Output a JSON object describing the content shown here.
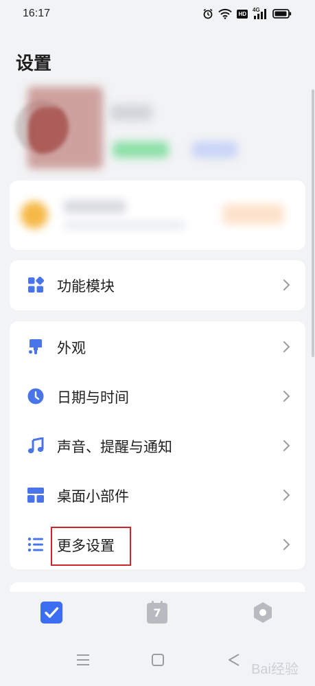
{
  "status_bar": {
    "time": "16:17",
    "hd_badge": "HD",
    "network": "4G",
    "battery_percent": 85
  },
  "page": {
    "title": "设置"
  },
  "module_card": {
    "label": "功能模块"
  },
  "settings_list": {
    "items": [
      {
        "label": "外观",
        "icon": "paint-brush-icon"
      },
      {
        "label": "日期与时间",
        "icon": "clock-icon"
      },
      {
        "label": "声音、提醒与通知",
        "icon": "music-note-icon"
      },
      {
        "label": "桌面小部件",
        "icon": "widget-icon"
      },
      {
        "label": "更多设置",
        "icon": "list-icon"
      }
    ]
  },
  "bottom_nav": {
    "calendar_day": "7",
    "active_tab": "tasks"
  },
  "colors": {
    "accent": "#3b6ef0",
    "icon_blue": "#4a74ea",
    "highlight": "#d1232a",
    "nav_inactive": "#b8babf"
  },
  "watermark": "Bai经验"
}
